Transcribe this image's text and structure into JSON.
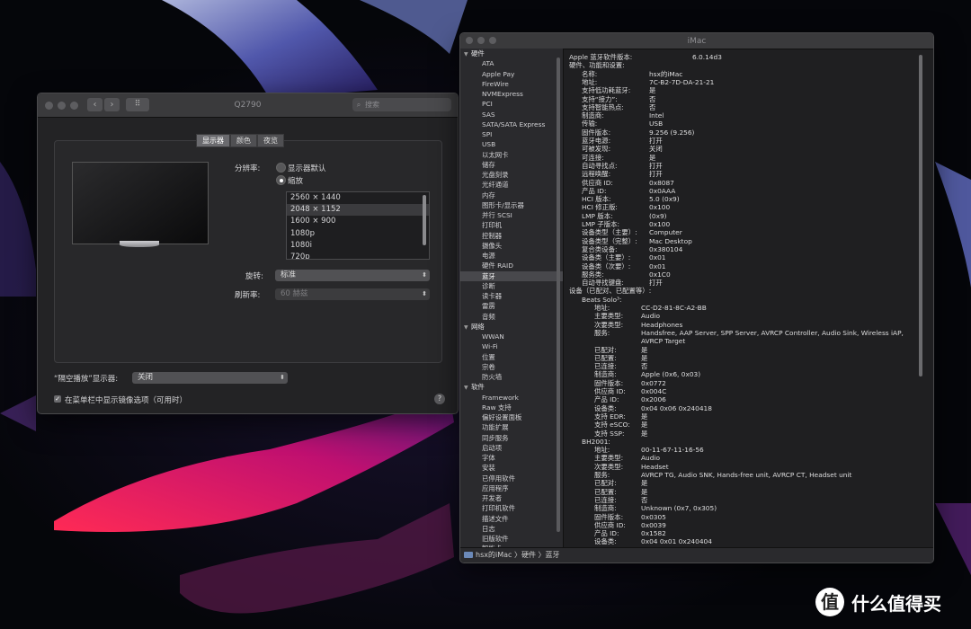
{
  "display_prefs": {
    "title": "Q2790",
    "search_placeholder": "搜索",
    "tabs": [
      "显示器",
      "颜色",
      "夜览"
    ],
    "resolution_label": "分辨率:",
    "option_default": "显示器默认",
    "option_scaled": "缩放",
    "resolutions": [
      "2560 × 1440",
      "2048 × 1152",
      "1600 × 900",
      "1080p",
      "1080i",
      "720p"
    ],
    "rotation_label": "旋转:",
    "rotation_value": "标准",
    "refresh_label": "刷新率:",
    "refresh_value": "60 赫兹",
    "airplay_label": "“隔空播放”显示器:",
    "airplay_value": "关闭",
    "mirror_checkbox": "在菜单栏中显示镜像选项（可用时）",
    "nav_back": "‹",
    "nav_forward": "›",
    "grid_glyph": "⠿",
    "help_glyph": "?"
  },
  "sysinfo": {
    "title": "iMac",
    "sidebar": [
      {
        "type": "cat",
        "label": "硬件"
      },
      {
        "type": "item",
        "label": "ATA"
      },
      {
        "type": "item",
        "label": "Apple Pay"
      },
      {
        "type": "item",
        "label": "FireWire"
      },
      {
        "type": "item",
        "label": "NVMExpress"
      },
      {
        "type": "item",
        "label": "PCI"
      },
      {
        "type": "item",
        "label": "SAS"
      },
      {
        "type": "item",
        "label": "SATA/SATA Express"
      },
      {
        "type": "item",
        "label": "SPI"
      },
      {
        "type": "item",
        "label": "USB"
      },
      {
        "type": "item",
        "label": "以太网卡"
      },
      {
        "type": "item",
        "label": "储存"
      },
      {
        "type": "item",
        "label": "光盘刻录"
      },
      {
        "type": "item",
        "label": "光纤通道"
      },
      {
        "type": "item",
        "label": "内存"
      },
      {
        "type": "item",
        "label": "图形卡/显示器"
      },
      {
        "type": "item",
        "label": "并行 SCSI"
      },
      {
        "type": "item",
        "label": "打印机"
      },
      {
        "type": "item",
        "label": "控制器"
      },
      {
        "type": "item",
        "label": "摄像头"
      },
      {
        "type": "item",
        "label": "电源"
      },
      {
        "type": "item",
        "label": "硬件 RAID"
      },
      {
        "type": "item",
        "label": "蓝牙",
        "selected": true
      },
      {
        "type": "item",
        "label": "诊断"
      },
      {
        "type": "item",
        "label": "读卡器"
      },
      {
        "type": "item",
        "label": "雷雳"
      },
      {
        "type": "item",
        "label": "音频"
      },
      {
        "type": "cat",
        "label": "网络"
      },
      {
        "type": "item",
        "label": "WWAN"
      },
      {
        "type": "item",
        "label": "Wi-Fi"
      },
      {
        "type": "item",
        "label": "位置"
      },
      {
        "type": "item",
        "label": "宗卷"
      },
      {
        "type": "item",
        "label": "防火墙"
      },
      {
        "type": "cat",
        "label": "软件"
      },
      {
        "type": "item",
        "label": "Framework"
      },
      {
        "type": "item",
        "label": "Raw 支持"
      },
      {
        "type": "item",
        "label": "偏好设置面板"
      },
      {
        "type": "item",
        "label": "功能扩展"
      },
      {
        "type": "item",
        "label": "同步服务"
      },
      {
        "type": "item",
        "label": "启动项"
      },
      {
        "type": "item",
        "label": "字体"
      },
      {
        "type": "item",
        "label": "安装"
      },
      {
        "type": "item",
        "label": "已停用软件"
      },
      {
        "type": "item",
        "label": "应用程序"
      },
      {
        "type": "item",
        "label": "开发者"
      },
      {
        "type": "item",
        "label": "打印机软件"
      },
      {
        "type": "item",
        "label": "描述文件"
      },
      {
        "type": "item",
        "label": "日志"
      },
      {
        "type": "item",
        "label": "旧版软件"
      },
      {
        "type": "item",
        "label": "智能卡"
      }
    ],
    "details": [
      {
        "lvl": 0,
        "k": "Apple 蓝牙软件版本:",
        "v": "6.0.14d3"
      },
      {
        "lvl": 0,
        "k": "硬件、功能和设置:",
        "v": ""
      },
      {
        "lvl": 1,
        "k": "名称:",
        "v": "hsx的iMac"
      },
      {
        "lvl": 1,
        "k": "地址:",
        "v": "7C-B2-7D-DA-21-21"
      },
      {
        "lvl": 1,
        "k": "支持低功耗蓝牙:",
        "v": "是"
      },
      {
        "lvl": 1,
        "k": "支持“接力”:",
        "v": "否"
      },
      {
        "lvl": 1,
        "k": "支持智能热点:",
        "v": "否"
      },
      {
        "lvl": 1,
        "k": "制造商:",
        "v": "Intel"
      },
      {
        "lvl": 1,
        "k": "传输:",
        "v": "USB"
      },
      {
        "lvl": 1,
        "k": "固件版本:",
        "v": "9.256 (9.256)"
      },
      {
        "lvl": 1,
        "k": "蓝牙电源:",
        "v": "打开"
      },
      {
        "lvl": 1,
        "k": "可被发现:",
        "v": "关闭"
      },
      {
        "lvl": 1,
        "k": "可连接:",
        "v": "是"
      },
      {
        "lvl": 1,
        "k": "自动寻找点:",
        "v": "打开"
      },
      {
        "lvl": 1,
        "k": "远程唤醒:",
        "v": "打开"
      },
      {
        "lvl": 1,
        "k": "供应商 ID:",
        "v": "0x8087"
      },
      {
        "lvl": 1,
        "k": "产品 ID:",
        "v": "0x0AAA"
      },
      {
        "lvl": 1,
        "k": "HCI 版本:",
        "v": "5.0 (0x9)"
      },
      {
        "lvl": 1,
        "k": "HCI 修正版:",
        "v": "0x100"
      },
      {
        "lvl": 1,
        "k": "LMP 版本:",
        "v": "(0x9)"
      },
      {
        "lvl": 1,
        "k": "LMP 子版本:",
        "v": "0x100"
      },
      {
        "lvl": 1,
        "k": "设备类型（主要）:",
        "v": "Computer"
      },
      {
        "lvl": 1,
        "k": "设备类型（完整）:",
        "v": "Mac Desktop"
      },
      {
        "lvl": 1,
        "k": "复合类设备:",
        "v": "0x380104"
      },
      {
        "lvl": 1,
        "k": "设备类（主要）:",
        "v": "0x01"
      },
      {
        "lvl": 1,
        "k": "设备类（次要）:",
        "v": "0x01"
      },
      {
        "lvl": 1,
        "k": "服务类:",
        "v": "0x1C0"
      },
      {
        "lvl": 1,
        "k": "自动寻找键盘:",
        "v": "打开"
      },
      {
        "lvl": 0,
        "k": "设备（已配对、已配置等）:",
        "v": ""
      },
      {
        "lvl": 1,
        "k": "Beats Solo³:",
        "v": ""
      },
      {
        "lvl": 2,
        "k": "地址:",
        "v": "CC-D2-81-8C-A2-BB"
      },
      {
        "lvl": 2,
        "k": "主要类型:",
        "v": "Audio"
      },
      {
        "lvl": 2,
        "k": "次要类型:",
        "v": "Headphones"
      },
      {
        "lvl": 2,
        "k": "服务:",
        "v": "Handsfree, AAP Server, SPP Server, AVRCP Controller, Audio Sink, Wireless iAP,"
      },
      {
        "lvl": 2,
        "k": "",
        "v": "AVRCP Target"
      },
      {
        "lvl": 2,
        "k": "已配对:",
        "v": "是"
      },
      {
        "lvl": 2,
        "k": "已配置:",
        "v": "是"
      },
      {
        "lvl": 2,
        "k": "已连接:",
        "v": "否"
      },
      {
        "lvl": 2,
        "k": "制造商:",
        "v": "Apple (0x6, 0x03)"
      },
      {
        "lvl": 2,
        "k": "固件版本:",
        "v": "0x0772"
      },
      {
        "lvl": 2,
        "k": "供应商 ID:",
        "v": "0x004C"
      },
      {
        "lvl": 2,
        "k": "产品 ID:",
        "v": "0x2006"
      },
      {
        "lvl": 2,
        "k": "设备类:",
        "v": "0x04 0x06 0x240418"
      },
      {
        "lvl": 2,
        "k": "支持 EDR:",
        "v": "是"
      },
      {
        "lvl": 2,
        "k": "支持 eSCO:",
        "v": "是"
      },
      {
        "lvl": 2,
        "k": "支持 SSP:",
        "v": "是"
      },
      {
        "lvl": 1,
        "k": "BH2001:",
        "v": ""
      },
      {
        "lvl": 2,
        "k": "地址:",
        "v": "00-11-67-11-16-56"
      },
      {
        "lvl": 2,
        "k": "主要类型:",
        "v": "Audio"
      },
      {
        "lvl": 2,
        "k": "次要类型:",
        "v": "Headset"
      },
      {
        "lvl": 2,
        "k": "服务:",
        "v": "AVRCP TG, Audio SNK, Hands-free unit, AVRCP CT, Headset unit"
      },
      {
        "lvl": 2,
        "k": "已配对:",
        "v": "是"
      },
      {
        "lvl": 2,
        "k": "已配置:",
        "v": "是"
      },
      {
        "lvl": 2,
        "k": "已连接:",
        "v": "否"
      },
      {
        "lvl": 2,
        "k": "制造商:",
        "v": "Unknown (0x7, 0x305)"
      },
      {
        "lvl": 2,
        "k": "固件版本:",
        "v": "0x0305"
      },
      {
        "lvl": 2,
        "k": "供应商 ID:",
        "v": "0x0039"
      },
      {
        "lvl": 2,
        "k": "产品 ID:",
        "v": "0x1582"
      },
      {
        "lvl": 2,
        "k": "设备类:",
        "v": "0x04 0x01 0x240404"
      }
    ],
    "breadcrumb": "hsx的iMac 〉硬件 〉蓝牙"
  },
  "watermark": {
    "badge": "值",
    "text": "什么值得买"
  }
}
